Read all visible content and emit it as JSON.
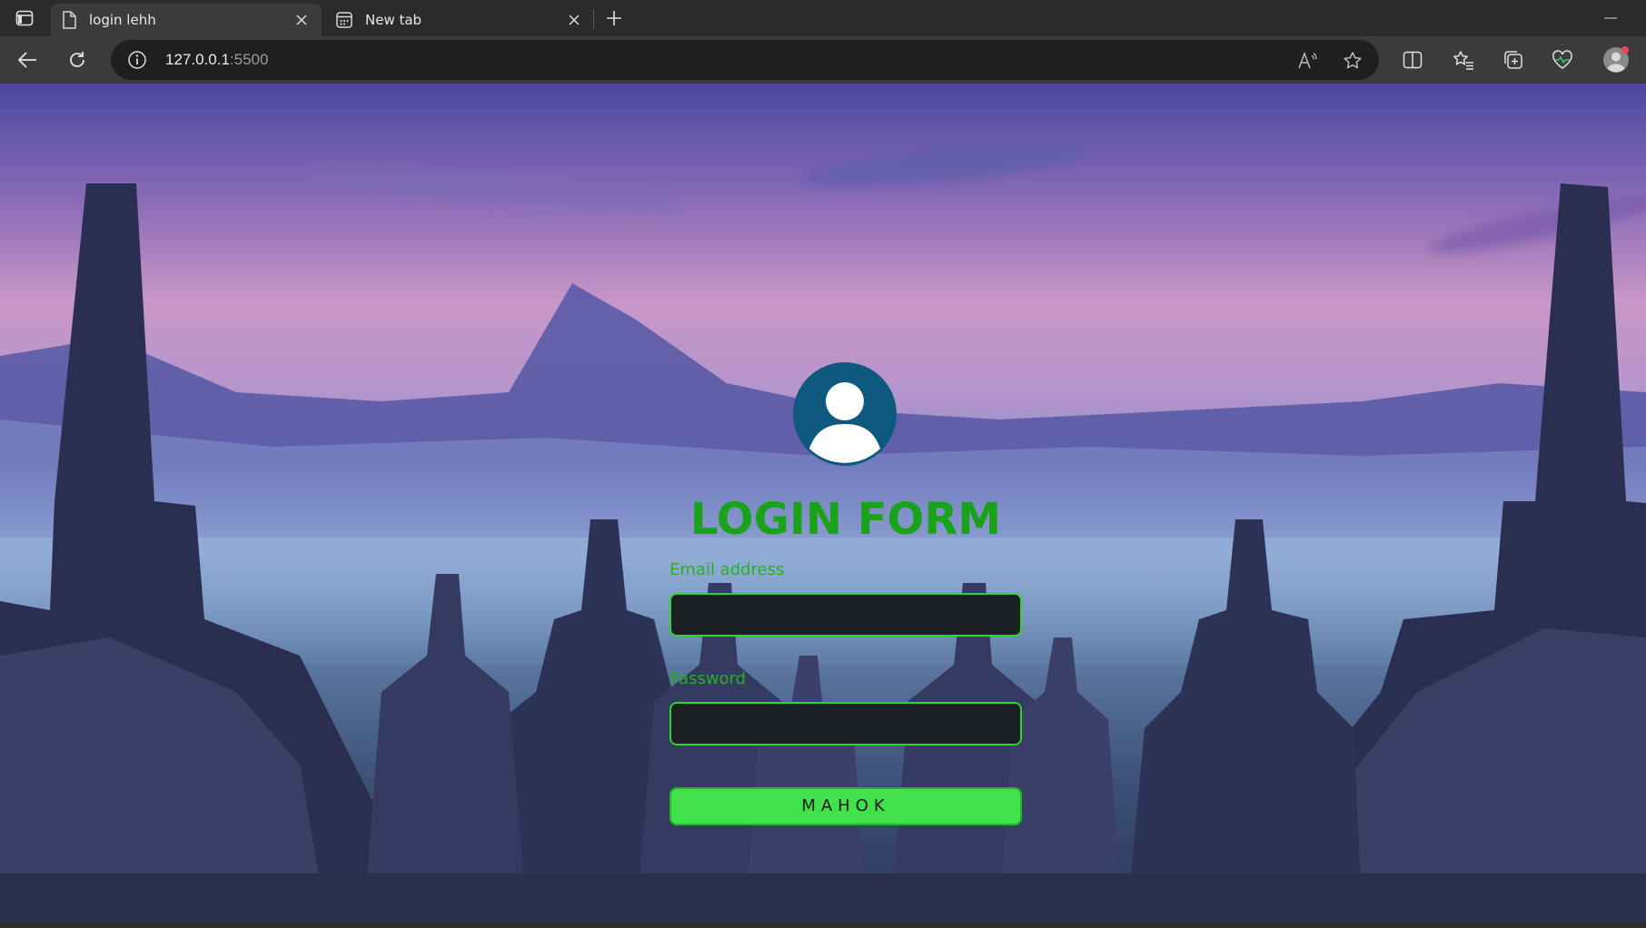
{
  "browser": {
    "tabs": [
      {
        "title": "login lehh",
        "active": true
      },
      {
        "title": "New tab",
        "active": false
      }
    ],
    "address": {
      "host": "127.0.0.1",
      "port": ":5500"
    }
  },
  "login_form": {
    "title": "LOGIN FORM",
    "email_label": "Email address",
    "email_value": "",
    "password_label": "Password",
    "password_value": "",
    "submit_label": "MAHOK"
  },
  "colors": {
    "accent_green": "#1aa31a",
    "button_green": "#42e04a",
    "avatar_blue": "#0d5a7e"
  }
}
